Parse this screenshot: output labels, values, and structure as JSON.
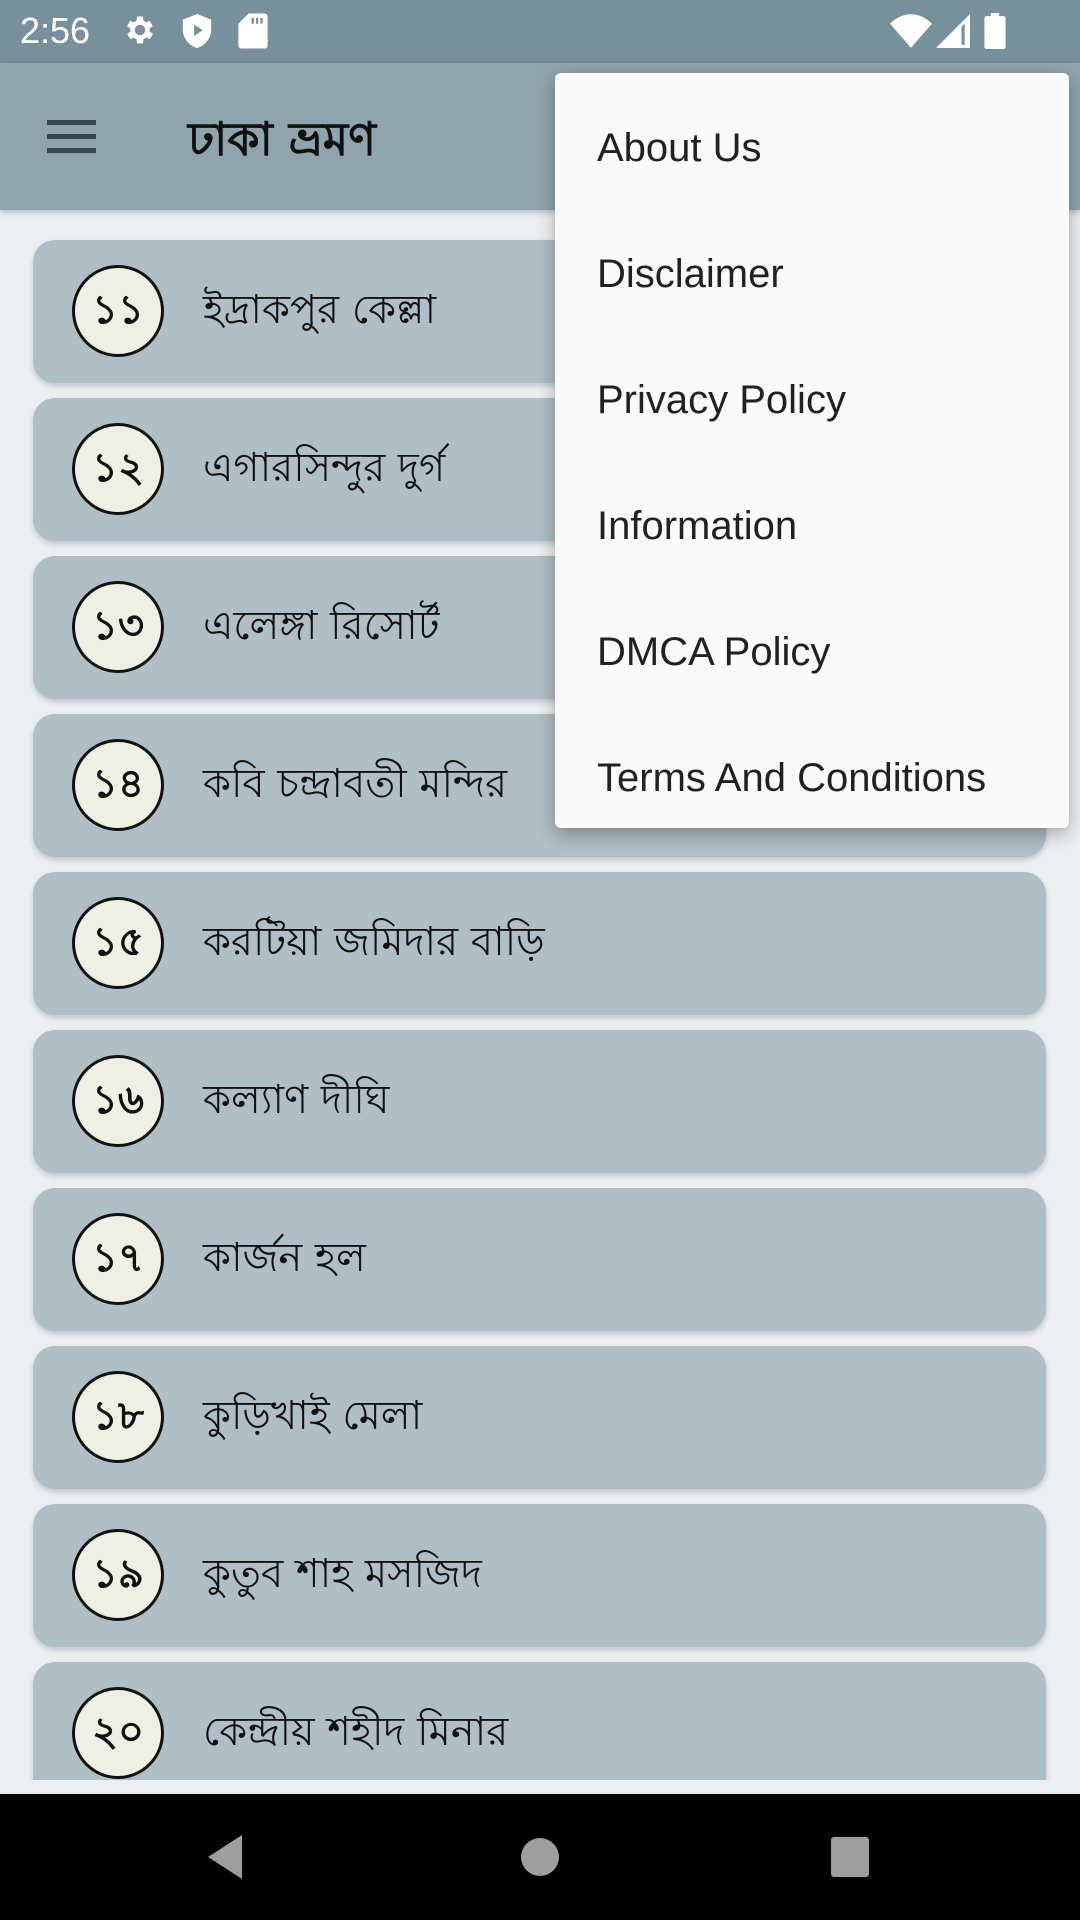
{
  "status_bar": {
    "time": "2:56",
    "left_icons": [
      "gear-icon",
      "shield-play-icon",
      "sd-card-icon"
    ],
    "right_icons": [
      "wifi-icon",
      "cell-signal-icon",
      "battery-icon"
    ]
  },
  "app_bar": {
    "menu_icon": "hamburger-icon",
    "title": "ঢাকা ভ্রমণ"
  },
  "list": {
    "items": [
      {
        "number": "১১",
        "label": "ইদ্রাকপুর কেল্লা"
      },
      {
        "number": "১২",
        "label": "এগারসিন্দুর দুর্গ"
      },
      {
        "number": "১৩",
        "label": "এলেঙ্গা রিসোর্ট"
      },
      {
        "number": "১৪",
        "label": "কবি চন্দ্রাবতী মন্দির"
      },
      {
        "number": "১৫",
        "label": "করটিয়া জমিদার বাড়ি"
      },
      {
        "number": "১৬",
        "label": "কল্যাণ দীঘি"
      },
      {
        "number": "১৭",
        "label": "কার্জন হল"
      },
      {
        "number": "১৮",
        "label": "কুড়িখাই মেলা"
      },
      {
        "number": "১৯",
        "label": "কুতুব শাহ মসজিদ"
      },
      {
        "number": "২০",
        "label": "কেন্দ্রীয় শহীদ মিনার"
      }
    ]
  },
  "overflow_menu": {
    "items": [
      {
        "label": "About Us"
      },
      {
        "label": "Disclaimer"
      },
      {
        "label": "Privacy Policy"
      },
      {
        "label": "Information"
      },
      {
        "label": "DMCA Policy"
      },
      {
        "label": "Terms And Conditions"
      }
    ]
  },
  "nav_bar": {
    "buttons": [
      "back-icon",
      "home-icon",
      "recents-icon"
    ]
  },
  "colors": {
    "status_bar": "#78909c",
    "app_bar": "#90a4ae",
    "card": "#b0bec5",
    "circle": "#eef0e3",
    "background": "#eceff1",
    "menu": "#fafafa"
  }
}
